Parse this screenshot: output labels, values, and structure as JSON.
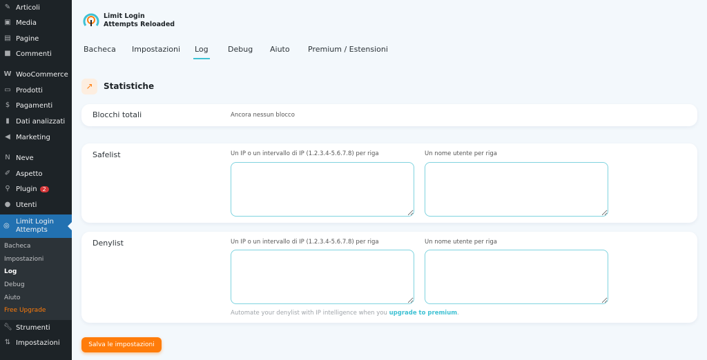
{
  "sidebar": {
    "items": [
      {
        "label": "Articoli",
        "icon": "pin-icon"
      },
      {
        "label": "Media",
        "icon": "media-icon"
      },
      {
        "label": "Pagine",
        "icon": "pages-icon"
      },
      {
        "label": "Commenti",
        "icon": "comment-icon"
      },
      {
        "label": "WooCommerce",
        "icon": "woo-icon"
      },
      {
        "label": "Prodotti",
        "icon": "box-icon"
      },
      {
        "label": "Pagamenti",
        "icon": "dollar-icon"
      },
      {
        "label": "Dati analizzati",
        "icon": "chart-icon"
      },
      {
        "label": "Marketing",
        "icon": "megaphone-icon"
      },
      {
        "label": "Neve",
        "icon": "neve-icon"
      },
      {
        "label": "Aspetto",
        "icon": "brush-icon"
      },
      {
        "label": "Plugin",
        "icon": "plugin-icon",
        "badge": "2"
      },
      {
        "label": "Utenti",
        "icon": "user-icon"
      }
    ],
    "active": "Limit Login Attempts",
    "sub": [
      "Bacheca",
      "Impostazioni",
      "Log",
      "Debug",
      "Aiuto",
      "Free Upgrade"
    ],
    "after": [
      {
        "label": "Strumenti",
        "icon": "wrench-icon"
      },
      {
        "label": "Impostazioni",
        "icon": "settings-icon"
      }
    ]
  },
  "logo": {
    "line1": "Limit Login",
    "line2": "Attempts Reloaded"
  },
  "tabs": [
    "Bacheca",
    "Impostazioni",
    "Log",
    "Debug",
    "Aiuto",
    "Premium / Estensioni"
  ],
  "active_tab": "Log",
  "section_title": "Statistiche",
  "blocks": {
    "label": "Blocchi totali",
    "value": "Ancora nessun blocco"
  },
  "safelist": {
    "label": "Safelist",
    "ip_hint": "Un IP o un intervallo di IP (1.2.3.4-5.6.7.8) per riga",
    "user_hint": "Un nome utente per riga"
  },
  "denylist": {
    "label": "Denylist",
    "ip_hint": "Un IP o un intervallo di IP (1.2.3.4-5.6.7.8) per riga",
    "user_hint": "Un nome utente per riga",
    "note": "Automate your denylist with IP intelligence when you ",
    "note_link": "upgrade to premium",
    "note_end": "."
  },
  "save_label": "Salva le impostazioni",
  "colors": {
    "accent": "#3ec1d3",
    "orange": "#ff7c0a",
    "sidebar": "#1d2327",
    "active": "#2271b1"
  }
}
